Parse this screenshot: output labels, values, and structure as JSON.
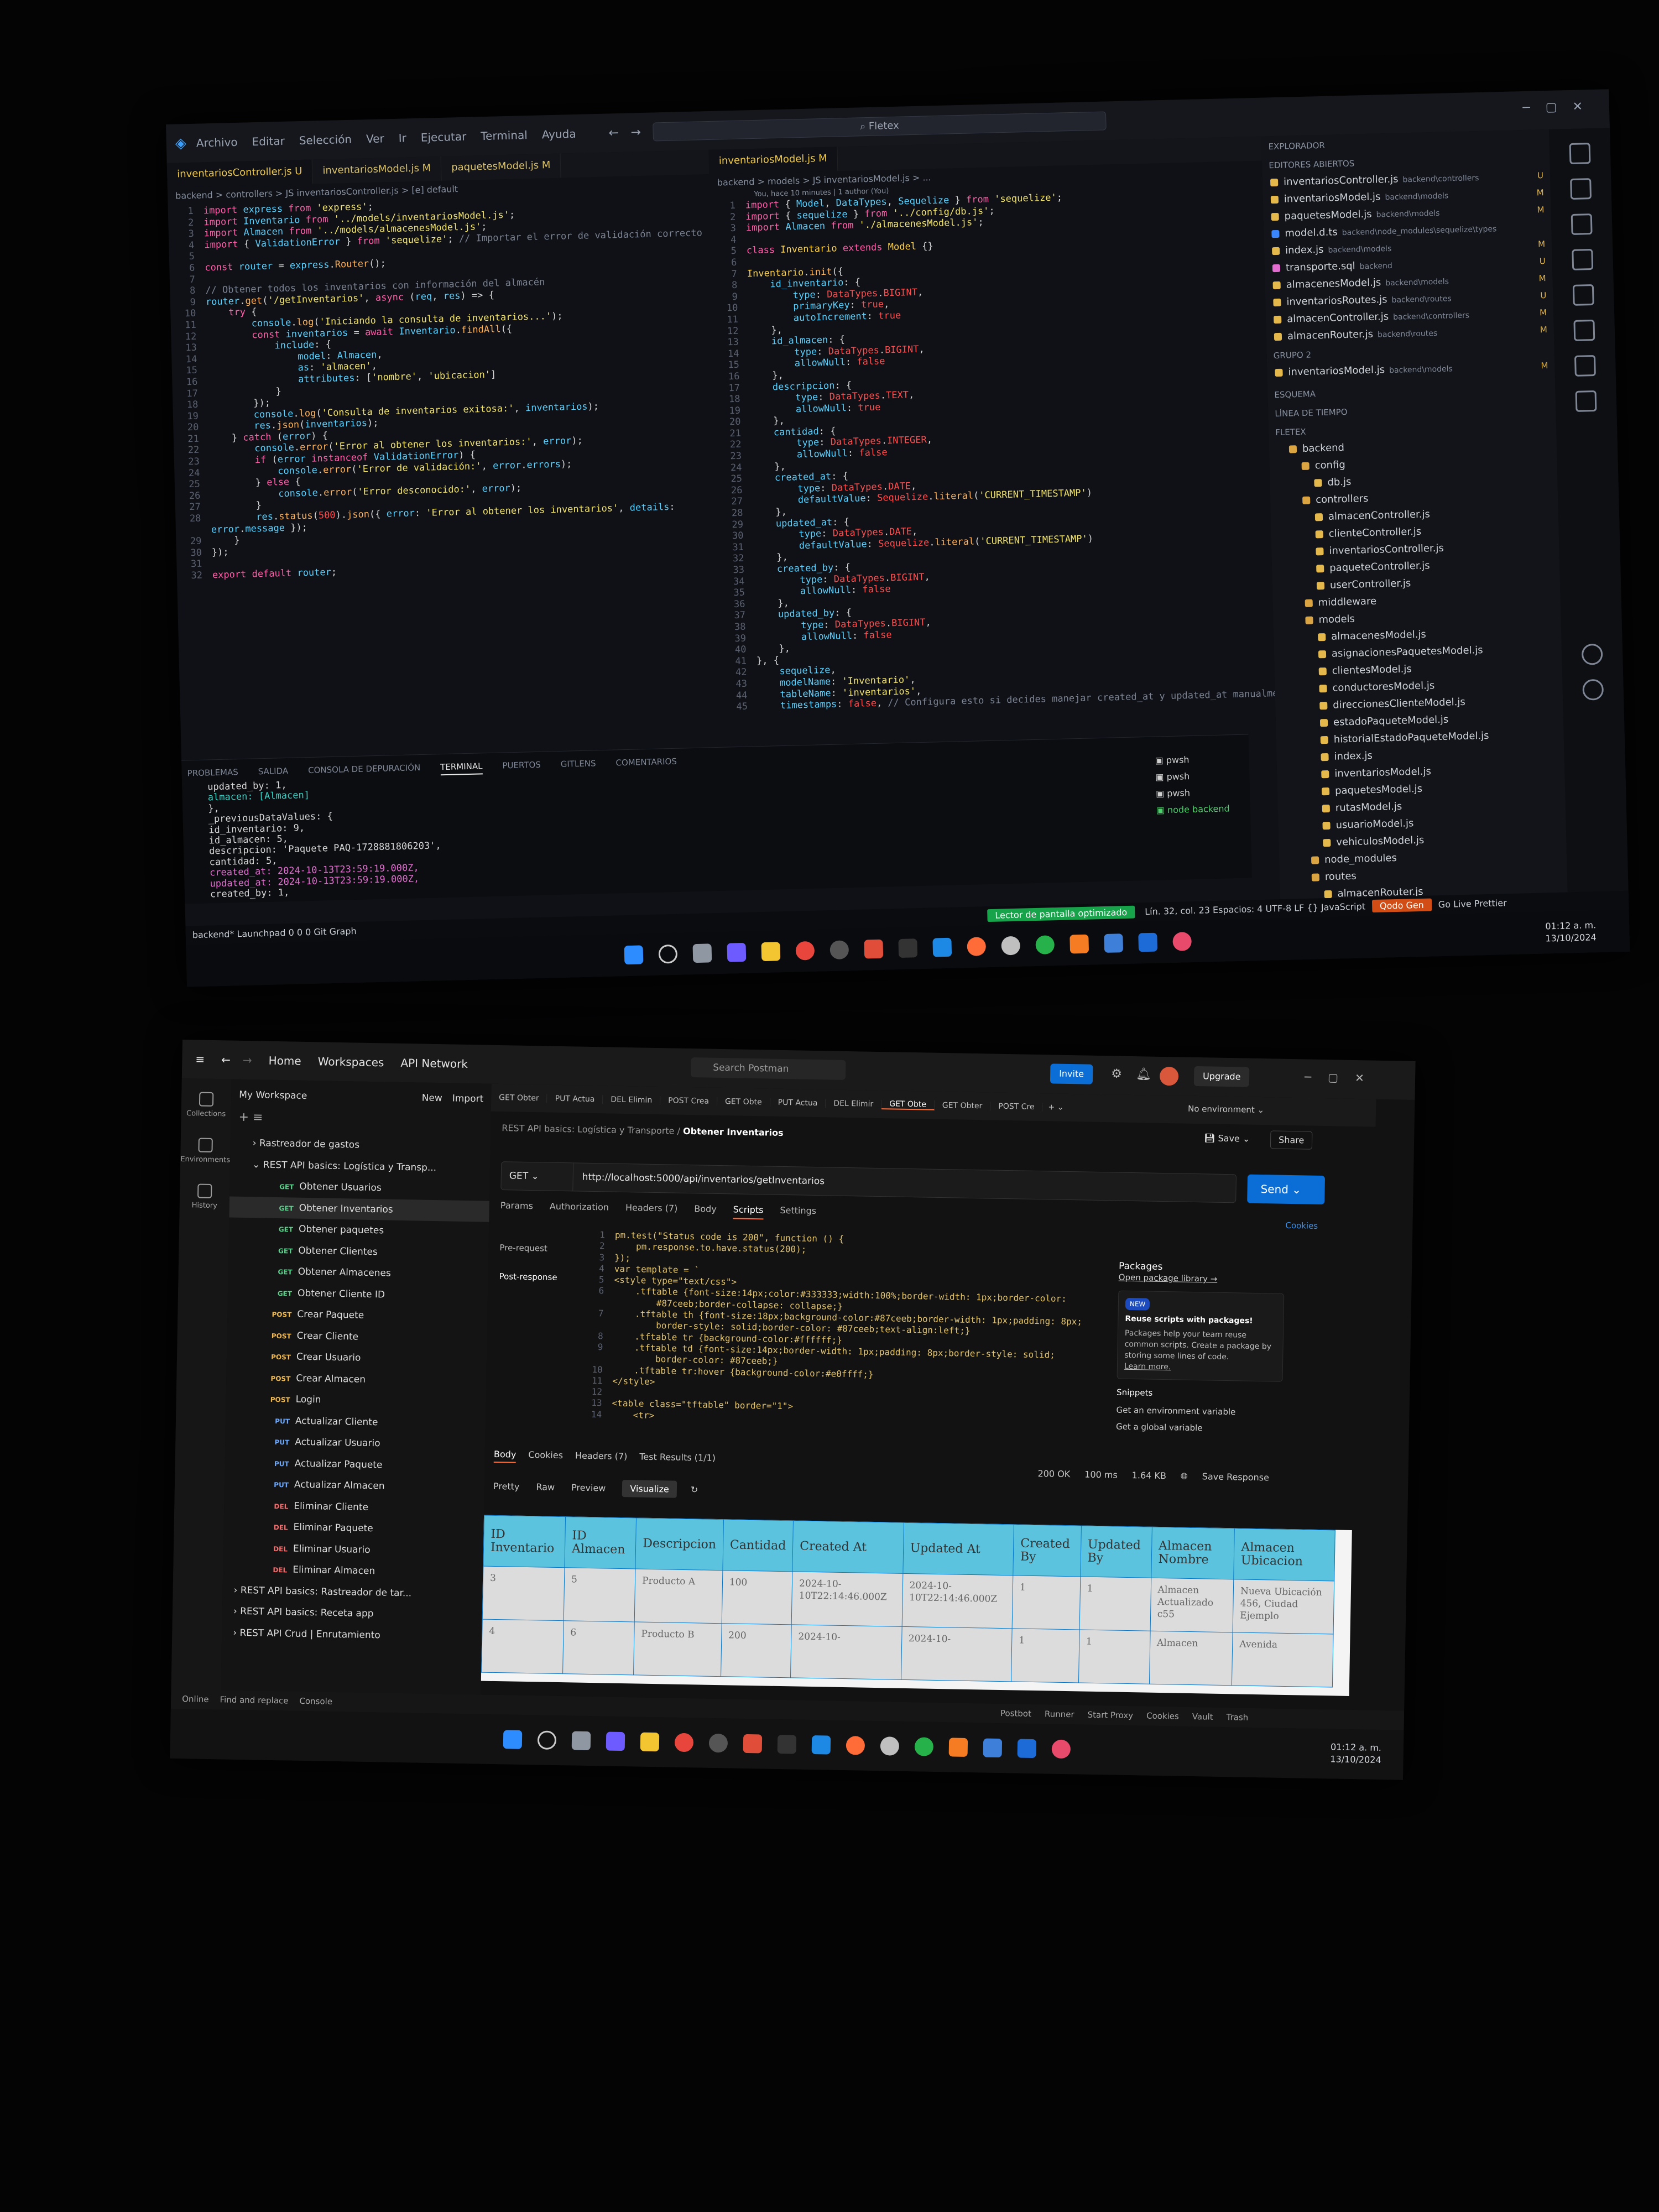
{
  "vscode": {
    "menu": [
      "Archivo",
      "Editar",
      "Selección",
      "Ver",
      "Ir",
      "Ejecutar",
      "Terminal",
      "Ayuda"
    ],
    "search": "Fletex",
    "tabs_left": [
      {
        "label": "inventariosController.js U",
        "active": true
      },
      {
        "label": "inventariosModel.js M",
        "active": false
      },
      {
        "label": "paquetesModel.js M",
        "active": false
      }
    ],
    "tabs_right": [
      {
        "label": "inventariosModel.js M",
        "active": true
      }
    ],
    "breadcrumb_left": "backend > controllers > JS inventariosController.js > [e] default",
    "breadcrumb_right": "backend > models > JS inventariosModel.js > ...",
    "blame": "You, hace 10 minutes | 1 author (You)",
    "panel_tabs": [
      "PROBLEMAS",
      "SALIDA",
      "CONSOLA DE DEPURACIÓN",
      "TERMINAL",
      "PUERTOS",
      "GITLENS",
      "COMENTARIOS"
    ],
    "terminal_lines": [
      "updated_by: 1,",
      "almacen: [Almacen]",
      "},",
      "_previousDataValues: {",
      "id_inventario: 9,",
      "id_almacen: 5,",
      "descripcion: 'Paquete PAQ-1728881806203',",
      "cantidad: 5,",
      "created_at: 2024-10-13T23:59:19.000Z,",
      "updated_at: 2024-10-13T23:59:19.000Z,",
      "created_by: 1,"
    ],
    "terminals": [
      "pwsh",
      "pwsh",
      "pwsh",
      "node backend"
    ],
    "explorer_title": "EXPLORADOR",
    "open_editors_title": "EDITORES ABIERTOS",
    "open_editors": [
      {
        "name": "inventariosController.js",
        "dir": "backend\\controllers",
        "status": "U"
      },
      {
        "name": "inventariosModel.js",
        "dir": "backend\\models",
        "status": "M"
      },
      {
        "name": "paquetesModel.js",
        "dir": "backend\\models",
        "status": "M"
      },
      {
        "name": "model.d.ts",
        "dir": "backend\\node_modules\\sequelize\\types",
        "status": ""
      },
      {
        "name": "index.js",
        "dir": "backend\\models",
        "status": "M"
      },
      {
        "name": "transporte.sql",
        "dir": "backend",
        "status": "U"
      },
      {
        "name": "almacenesModel.js",
        "dir": "backend\\models",
        "status": "M"
      },
      {
        "name": "inventariosRoutes.js",
        "dir": "backend\\routes",
        "status": "U"
      },
      {
        "name": "almacenController.js",
        "dir": "backend\\controllers",
        "status": "M"
      },
      {
        "name": "almacenRouter.js",
        "dir": "backend\\routes",
        "status": "M"
      }
    ],
    "group2_title": "GRUPO 2",
    "group2": [
      {
        "name": "inventariosModel.js",
        "dir": "backend\\models",
        "status": "M"
      }
    ],
    "sections": [
      "ESQUEMA",
      "LÍNEA DE TIEMPO",
      "FLETEX"
    ],
    "tree": [
      {
        "name": "backend",
        "depth": 1,
        "folder": true
      },
      {
        "name": "config",
        "depth": 2,
        "folder": true
      },
      {
        "name": "db.js",
        "depth": 3,
        "folder": false
      },
      {
        "name": "controllers",
        "depth": 2,
        "folder": true
      },
      {
        "name": "almacenController.js",
        "depth": 3,
        "folder": false
      },
      {
        "name": "clienteController.js",
        "depth": 3,
        "folder": false
      },
      {
        "name": "inventariosController.js",
        "depth": 3,
        "folder": false
      },
      {
        "name": "paqueteController.js",
        "depth": 3,
        "folder": false
      },
      {
        "name": "userController.js",
        "depth": 3,
        "folder": false
      },
      {
        "name": "middleware",
        "depth": 2,
        "folder": true
      },
      {
        "name": "models",
        "depth": 2,
        "folder": true
      },
      {
        "name": "almacenesModel.js",
        "depth": 3,
        "folder": false
      },
      {
        "name": "asignacionesPaquetesModel.js",
        "depth": 3,
        "folder": false
      },
      {
        "name": "clientesModel.js",
        "depth": 3,
        "folder": false
      },
      {
        "name": "conductoresModel.js",
        "depth": 3,
        "folder": false
      },
      {
        "name": "direccionesClienteModel.js",
        "depth": 3,
        "folder": false
      },
      {
        "name": "estadoPaqueteModel.js",
        "depth": 3,
        "folder": false
      },
      {
        "name": "historialEstadoPaqueteModel.js",
        "depth": 3,
        "folder": false
      },
      {
        "name": "index.js",
        "depth": 3,
        "folder": false
      },
      {
        "name": "inventariosModel.js",
        "depth": 3,
        "folder": false
      },
      {
        "name": "paquetesModel.js",
        "depth": 3,
        "folder": false
      },
      {
        "name": "rutasModel.js",
        "depth": 3,
        "folder": false
      },
      {
        "name": "usuarioModel.js",
        "depth": 3,
        "folder": false
      },
      {
        "name": "vehiculosModel.js",
        "depth": 3,
        "folder": false
      },
      {
        "name": "node_modules",
        "depth": 2,
        "folder": true
      },
      {
        "name": "routes",
        "depth": 2,
        "folder": true
      },
      {
        "name": "almacenRouter.js",
        "depth": 3,
        "folder": false
      }
    ],
    "status_left": "backend*   Launchpad   0  0  0   Git Graph",
    "status_badge": "Lector de pantalla optimizado",
    "status_right": "Lín. 32, col. 23   Espacios: 4   UTF-8   LF   {} JavaScript",
    "status_qodo": "Qodo Gen",
    "status_tail": "Go Live   Prettier",
    "time": "01:12 a. m.",
    "date": "13/10/2024"
  },
  "postman": {
    "nav": [
      "Home",
      "Workspaces",
      "API Network"
    ],
    "search": "Search Postman",
    "invite": "Invite",
    "upgrade": "Upgrade",
    "workspace": "My Workspace",
    "new": "New",
    "import": "Import",
    "left_items": [
      "Collections",
      "Environments",
      "History"
    ],
    "collections": [
      {
        "type": "folder",
        "name": "Rastreador de gastos"
      },
      {
        "type": "folder",
        "name": "REST API basics: Logística y Transp..."
      }
    ],
    "requests": [
      {
        "m": "GET",
        "name": "Obtener Usuarios"
      },
      {
        "m": "GET",
        "name": "Obtener Inventarios"
      },
      {
        "m": "GET",
        "name": "Obtener paquetes"
      },
      {
        "m": "GET",
        "name": "Obtener Clientes"
      },
      {
        "m": "GET",
        "name": "Obtener Almacenes"
      },
      {
        "m": "GET",
        "name": "Obtener Cliente ID"
      },
      {
        "m": "POST",
        "name": "Crear Paquete"
      },
      {
        "m": "POST",
        "name": "Crear Cliente"
      },
      {
        "m": "POST",
        "name": "Crear Usuario"
      },
      {
        "m": "POST",
        "name": "Crear Almacen"
      },
      {
        "m": "POST",
        "name": "Login"
      },
      {
        "m": "PUT",
        "name": "Actualizar Cliente"
      },
      {
        "m": "PUT",
        "name": "Actualizar Usuario"
      },
      {
        "m": "PUT",
        "name": "Actualizar Paquete"
      },
      {
        "m": "PUT",
        "name": "Actualizar Almacen"
      },
      {
        "m": "DEL",
        "name": "Eliminar Cliente"
      },
      {
        "m": "DEL",
        "name": "Eliminar Paquete"
      },
      {
        "m": "DEL",
        "name": "Eliminar Usuario"
      },
      {
        "m": "DEL",
        "name": "Eliminar Almacen"
      }
    ],
    "more_collections": [
      "REST API basics: Rastreador de tar...",
      "REST API basics: Receta app",
      "REST API Crud | Enrutamiento"
    ],
    "req_tabs": [
      {
        "m": "GET",
        "label": "GET Obter",
        "active": false
      },
      {
        "m": "PUT",
        "label": "PUT Actua",
        "active": false
      },
      {
        "m": "DEL",
        "label": "DEL Elimin",
        "active": false
      },
      {
        "m": "POST",
        "label": "POST Crea",
        "active": false
      },
      {
        "m": "GET",
        "label": "GET Obte",
        "active": false
      },
      {
        "m": "PUT",
        "label": "PUT Actua",
        "active": false
      },
      {
        "m": "DEL",
        "label": "DEL Elimir",
        "active": false
      },
      {
        "m": "GET",
        "label": "GET Obte",
        "active": true
      },
      {
        "m": "GET",
        "label": "GET Obter",
        "active": false
      },
      {
        "m": "POST",
        "label": "POST Cre",
        "active": false
      }
    ],
    "environment": "No environment",
    "breadcrumb": "REST API basics: Logística y Transporte  /",
    "request_title": "Obtener Inventarios",
    "save": "Save",
    "share": "Share",
    "method": "GET",
    "url": "http://localhost:5000/api/inventarios/getInventarios",
    "send": "Send",
    "cookies": "Cookies",
    "req_subtabs": [
      "Params",
      "Authorization",
      "Headers (7)",
      "Body",
      "Scripts",
      "Settings"
    ],
    "script_side": [
      "Pre-request",
      "Post-response"
    ],
    "script_lines": [
      "pm.test(\"Status code is 200\", function () {",
      "    pm.response.to.have.status(200);",
      "});",
      "var template = `",
      "<style type=\"text/css\">",
      "    .tftable {font-size:14px;color:#333333;width:100%;border-width: 1px;border-color:",
      "        #87ceeb;border-collapse: collapse;}",
      "    .tftable th {font-size:18px;background-color:#87ceeb;border-width: 1px;padding: 8px;",
      "        border-style: solid;border-color: #87ceeb;text-align:left;}",
      "    .tftable tr {background-color:#ffffff;}",
      "    .tftable td {font-size:14px;border-width: 1px;padding: 8px;border-style: solid;",
      "        border-color: #87ceeb;}",
      "    .tftable tr:hover {background-color:#e0ffff;}",
      "</style>",
      "",
      "<table class=\"tftable\" border=\"1\">",
      "    <tr>"
    ],
    "script_numbers": [
      "1",
      "2",
      "3",
      "4",
      "5",
      "6",
      "",
      "7",
      "",
      "8",
      "9",
      "",
      "10",
      "11",
      "12",
      "13",
      "14"
    ],
    "packages_title": "Packages",
    "packages_link": "Open package library →",
    "new_badge": "NEW",
    "reuse_title": "Reuse scripts with packages!",
    "reuse_text": "Packages help your team reuse common scripts. Create a package by storing some lines of code.",
    "learn_more": "Learn more.",
    "snippets_title": "Snippets",
    "snippets": [
      "Get an environment variable",
      "Get a global variable"
    ],
    "res_tabs": [
      "Body",
      "Cookies",
      "Headers (7)",
      "Test Results (1/1)"
    ],
    "res_views": [
      "Pretty",
      "Raw",
      "Preview",
      "Visualize"
    ],
    "res_meta": [
      "200 OK",
      "100 ms",
      "1.64 KB"
    ],
    "save_response": "Save Response",
    "table_headers": [
      "ID Inventario",
      "ID Almacen",
      "Descripcion",
      "Cantidad",
      "Created At",
      "Updated At",
      "Created By",
      "Updated By",
      "Almacen Nombre",
      "Almacen Ubicacion"
    ],
    "table_rows": [
      [
        "3",
        "5",
        "Producto A",
        "100",
        "2024-10-10T22:14:46.000Z",
        "2024-10-10T22:14:46.000Z",
        "1",
        "1",
        "Almacen Actualizado c55",
        "Nueva Ubicación 456, Ciudad Ejemplo"
      ],
      [
        "4",
        "6",
        "Producto B",
        "200",
        "2024-10-",
        "2024-10-",
        "1",
        "1",
        "Almacen",
        "Avenida"
      ]
    ],
    "status_left": [
      "Online",
      "Find and replace",
      "Console"
    ],
    "status_right": [
      "Postbot",
      "Runner",
      "Start Proxy",
      "Cookies",
      "Vault",
      "Trash"
    ],
    "time": "01:12 a. m.",
    "date": "13/10/2024"
  },
  "colors": {
    "accent_orange": "#ff6c37",
    "send_blue": "#0b6ed6",
    "table_header": "#87ceeb",
    "vs_green": "#17a34a",
    "vs_orange": "#d24d16"
  }
}
